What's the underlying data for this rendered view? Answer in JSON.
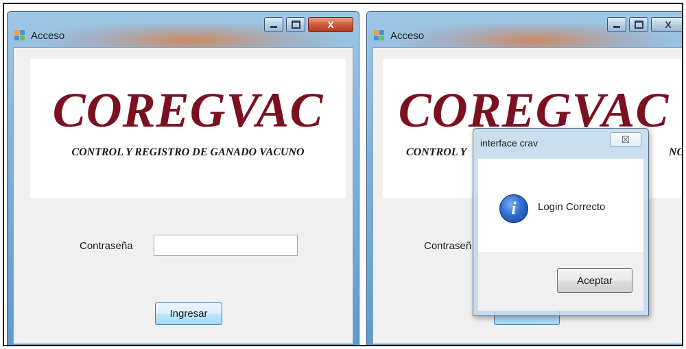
{
  "left_window": {
    "title": "Acceso",
    "logo_main": "COREGVAC",
    "logo_sub": "CONTROL Y REGISTRO DE GANADO VACUNO",
    "password_label": "Contraseña",
    "password_value": "",
    "login_button": "Ingresar",
    "close_glyph": "X"
  },
  "right_window": {
    "title": "Acceso",
    "logo_main": "COREGVAC",
    "logo_sub_left": "CONTROL Y",
    "logo_sub_right": "NO",
    "password_label_partial": "Contraseñ",
    "close_glyph": "X"
  },
  "dialog": {
    "title": "interface crav",
    "message": "Login Correcto",
    "ok_button": "Aceptar",
    "close_glyph": "☒",
    "icon": "info-icon"
  },
  "colors": {
    "logo_red": "#7a1020",
    "window_blue": "#7fb2dc"
  }
}
